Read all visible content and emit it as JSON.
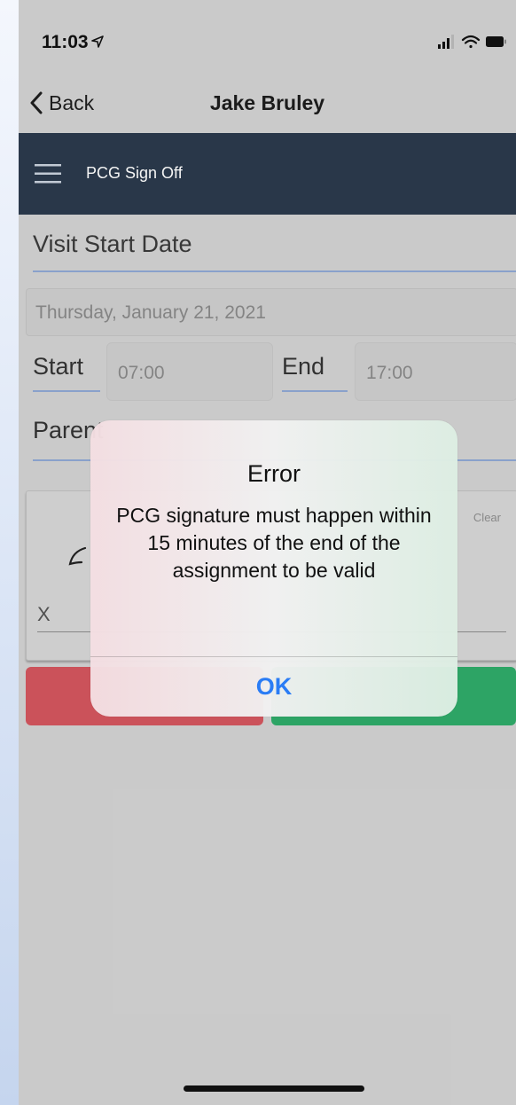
{
  "status_bar": {
    "time": "11:03",
    "location_icon": "location-arrow-icon",
    "signal_icon": "cellular-signal-icon",
    "wifi_icon": "wifi-icon",
    "battery_icon": "battery-icon"
  },
  "nav": {
    "back_label": "Back",
    "title": "Jake Bruley",
    "back_icon": "chevron-left-icon"
  },
  "header": {
    "title": "PCG Sign Off",
    "menu_icon": "hamburger-menu-icon",
    "background_color": "#2b3a4c"
  },
  "form": {
    "section_label": "Visit Start Date",
    "date_value": "Thursday, January 21, 2021",
    "start_label": "Start",
    "start_value": "07:00",
    "end_label": "End",
    "end_value": "17:00",
    "parent_label": "Parent",
    "signature": {
      "clear_label": "Clear",
      "x_label": "X"
    }
  },
  "buttons": {
    "cancel_color": "#d4565e",
    "confirm_color": "#2fab6a"
  },
  "alert": {
    "title": "Error",
    "message": "PCG signature must happen within 15 minutes of the end of the assignment to be valid",
    "ok_label": "OK",
    "ok_color": "#2a7cf5"
  }
}
